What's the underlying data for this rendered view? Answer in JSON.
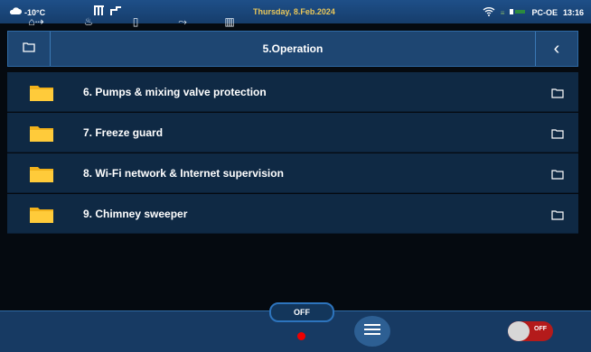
{
  "status_bar": {
    "temperature": "-10°C",
    "date": "Thursday, 8.Feb.2024",
    "device": "PC-OE",
    "time": "13:16",
    "icons": [
      "weather-icon",
      "heater-icon",
      "wifi-icon",
      "battery-icon"
    ]
  },
  "header": {
    "title": "5.Operation",
    "left_icon": "folder-outline-icon",
    "back_icon": "chevron-left-icon"
  },
  "menu": {
    "items": [
      {
        "label": "6.  Pumps & mixing valve protection"
      },
      {
        "label": "7.  Freeze guard"
      },
      {
        "label": "8.  Wi-Fi network & Internet supervision"
      },
      {
        "label": "9.  Chimney sweeper"
      }
    ]
  },
  "bottom_bar": {
    "status_label": "OFF",
    "toggle_label": "OFF",
    "tools": [
      "mode-icon",
      "flame-icon",
      "fuel-icon",
      "pump-icon",
      "radiator-icon"
    ]
  },
  "colors": {
    "folder": "#f2b21b",
    "accent": "#2d74bd",
    "date": "#e9c75a",
    "status_dot": "#e00000"
  }
}
